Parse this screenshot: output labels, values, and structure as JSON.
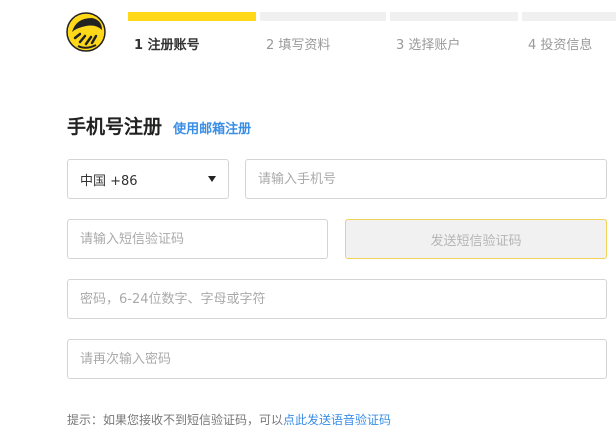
{
  "steps": [
    {
      "label": "1 注册账号"
    },
    {
      "label": "2 填写资料"
    },
    {
      "label": "3 选择账户"
    },
    {
      "label": "4 投资信息"
    }
  ],
  "form": {
    "title": "手机号注册",
    "switch_link": "使用邮箱注册",
    "country_value": "中国 +86",
    "phone_placeholder": "请输入手机号",
    "sms_placeholder": "请输入短信验证码",
    "send_sms_label": "发送短信验证码",
    "password_placeholder": "密码，6-24位数字、字母或字符",
    "password_confirm_placeholder": "请再次输入密码"
  },
  "hint": {
    "text": "提示：如果您接收不到短信验证码，可以",
    "link": "点此发送语音验证码"
  },
  "colors": {
    "accent": "#ffd919",
    "link": "#3a8ee6"
  },
  "icons": {
    "logo": "striped-ball-logo-icon",
    "select_caret": "caret-down-icon"
  }
}
